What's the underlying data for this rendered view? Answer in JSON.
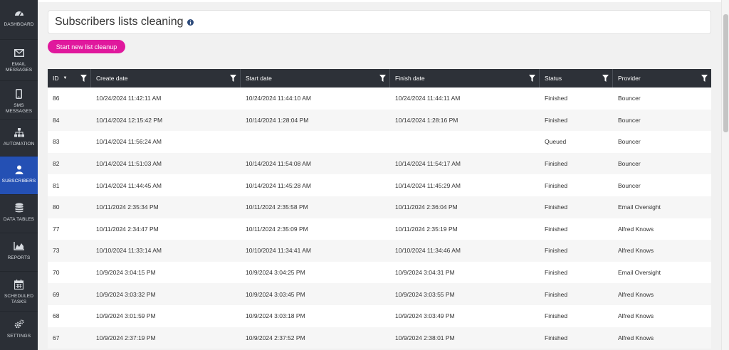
{
  "sidebar": {
    "items": [
      {
        "label": "DASHBOARD",
        "icon": "dashboard-icon"
      },
      {
        "label": "EMAIL MESSAGES",
        "icon": "envelope-icon"
      },
      {
        "label": "SMS MESSAGES",
        "icon": "mobile-icon"
      },
      {
        "label": "AUTOMATION",
        "icon": "sitemap-icon"
      },
      {
        "label": "SUBSCRIBERS",
        "icon": "user-icon",
        "active": true
      },
      {
        "label": "DATA TABLES",
        "icon": "database-icon"
      },
      {
        "label": "REPORTS",
        "icon": "area-chart-icon"
      },
      {
        "label": "SCHEDULED TASKS",
        "icon": "calendar-icon"
      },
      {
        "label": "SETTINGS",
        "icon": "gears-icon"
      }
    ]
  },
  "page": {
    "title": "Subscribers lists cleaning",
    "new_cleanup_button": "Start new list cleanup"
  },
  "table": {
    "columns": [
      {
        "label": "ID",
        "sort": "▼"
      },
      {
        "label": "Create date"
      },
      {
        "label": "Start date"
      },
      {
        "label": "Finish date"
      },
      {
        "label": "Status"
      },
      {
        "label": "Provider"
      }
    ],
    "rows": [
      {
        "id": "86",
        "create": "10/24/2024 11:42:11 AM",
        "start": "10/24/2024 11:44:10 AM",
        "finish": "10/24/2024 11:44:11 AM",
        "status": "Finished",
        "provider": "Bouncer"
      },
      {
        "id": "84",
        "create": "10/14/2024 12:15:42 PM",
        "start": "10/14/2024 1:28:04 PM",
        "finish": "10/14/2024 1:28:16 PM",
        "status": "Finished",
        "provider": "Bouncer"
      },
      {
        "id": "83",
        "create": "10/14/2024 11:56:24 AM",
        "start": "",
        "finish": "",
        "status": "Queued",
        "provider": "Bouncer"
      },
      {
        "id": "82",
        "create": "10/14/2024 11:51:03 AM",
        "start": "10/14/2024 11:54:08 AM",
        "finish": "10/14/2024 11:54:17 AM",
        "status": "Finished",
        "provider": "Bouncer"
      },
      {
        "id": "81",
        "create": "10/14/2024 11:44:45 AM",
        "start": "10/14/2024 11:45:28 AM",
        "finish": "10/14/2024 11:45:29 AM",
        "status": "Finished",
        "provider": "Bouncer"
      },
      {
        "id": "80",
        "create": "10/11/2024 2:35:34 PM",
        "start": "10/11/2024 2:35:58 PM",
        "finish": "10/11/2024 2:36:04 PM",
        "status": "Finished",
        "provider": "Email Oversight"
      },
      {
        "id": "77",
        "create": "10/11/2024 2:34:47 PM",
        "start": "10/11/2024 2:35:09 PM",
        "finish": "10/11/2024 2:35:19 PM",
        "status": "Finished",
        "provider": "Alfred Knows"
      },
      {
        "id": "73",
        "create": "10/10/2024 11:33:14 AM",
        "start": "10/10/2024 11:34:41 AM",
        "finish": "10/10/2024 11:34:46 AM",
        "status": "Finished",
        "provider": "Alfred Knows"
      },
      {
        "id": "70",
        "create": "10/9/2024 3:04:15 PM",
        "start": "10/9/2024 3:04:25 PM",
        "finish": "10/9/2024 3:04:31 PM",
        "status": "Finished",
        "provider": "Email Oversight"
      },
      {
        "id": "69",
        "create": "10/9/2024 3:03:32 PM",
        "start": "10/9/2024 3:03:45 PM",
        "finish": "10/9/2024 3:03:55 PM",
        "status": "Finished",
        "provider": "Alfred Knows"
      },
      {
        "id": "68",
        "create": "10/9/2024 3:01:59 PM",
        "start": "10/9/2024 3:03:18 PM",
        "finish": "10/9/2024 3:03:49 PM",
        "status": "Finished",
        "provider": "Alfred Knows"
      },
      {
        "id": "67",
        "create": "10/9/2024 2:37:19 PM",
        "start": "10/9/2024 2:37:52 PM",
        "finish": "10/9/2024 2:38:01 PM",
        "status": "Finished",
        "provider": "Alfred Knows"
      }
    ]
  },
  "colors": {
    "sidebar_bg": "#2b2f36",
    "active_nav": "#2450b4",
    "accent_button": "#e0189d",
    "table_header": "#2d3138"
  }
}
